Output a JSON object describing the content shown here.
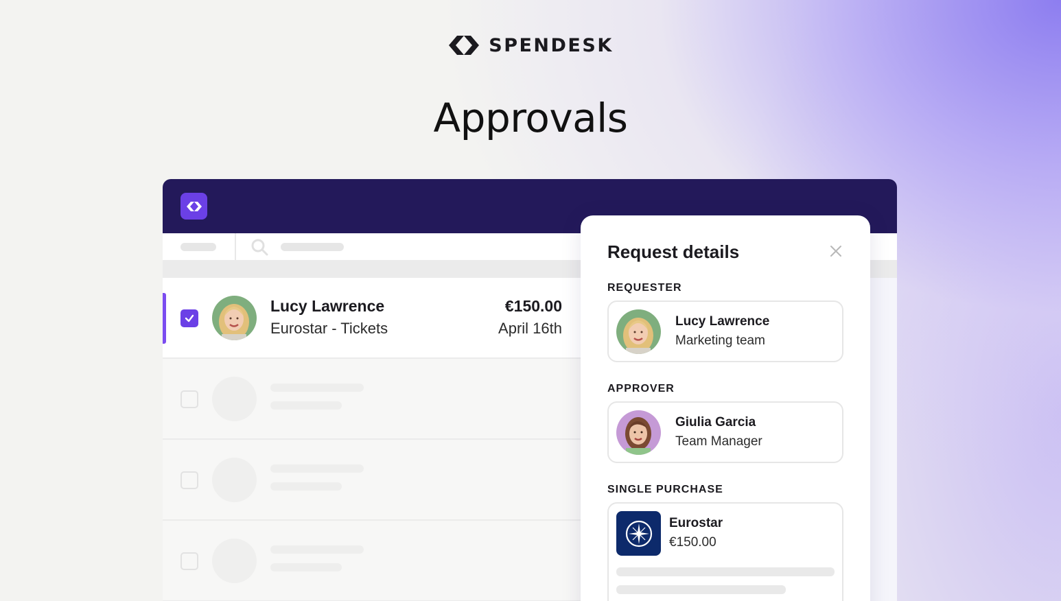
{
  "brand": {
    "name": "SPENDESK"
  },
  "headline": "Approvals",
  "list": {
    "selected_row": {
      "name": "Lucy Lawrence",
      "description": "Eurostar - Tickets",
      "amount": "€150.00",
      "date": "April 16th",
      "checked": true
    },
    "placeholder_rows": 3
  },
  "panel": {
    "title": "Request details",
    "requester": {
      "label": "REQUESTER",
      "name": "Lucy Lawrence",
      "team": "Marketing team"
    },
    "approver": {
      "label": "APPROVER",
      "name": "Giulia Garcia",
      "role": "Team Manager"
    },
    "purchase": {
      "label": "SINGLE PURCHASE",
      "merchant": "Eurostar",
      "amount": "€150.00"
    }
  },
  "colors": {
    "accent": "#6b40e6",
    "header": "#23195a",
    "merchant_logo_bg": "#0d2a6b"
  },
  "icons": [
    "spendesk-logo-icon",
    "search-icon",
    "checkmark-icon",
    "close-icon",
    "eurostar-logo-icon"
  ]
}
